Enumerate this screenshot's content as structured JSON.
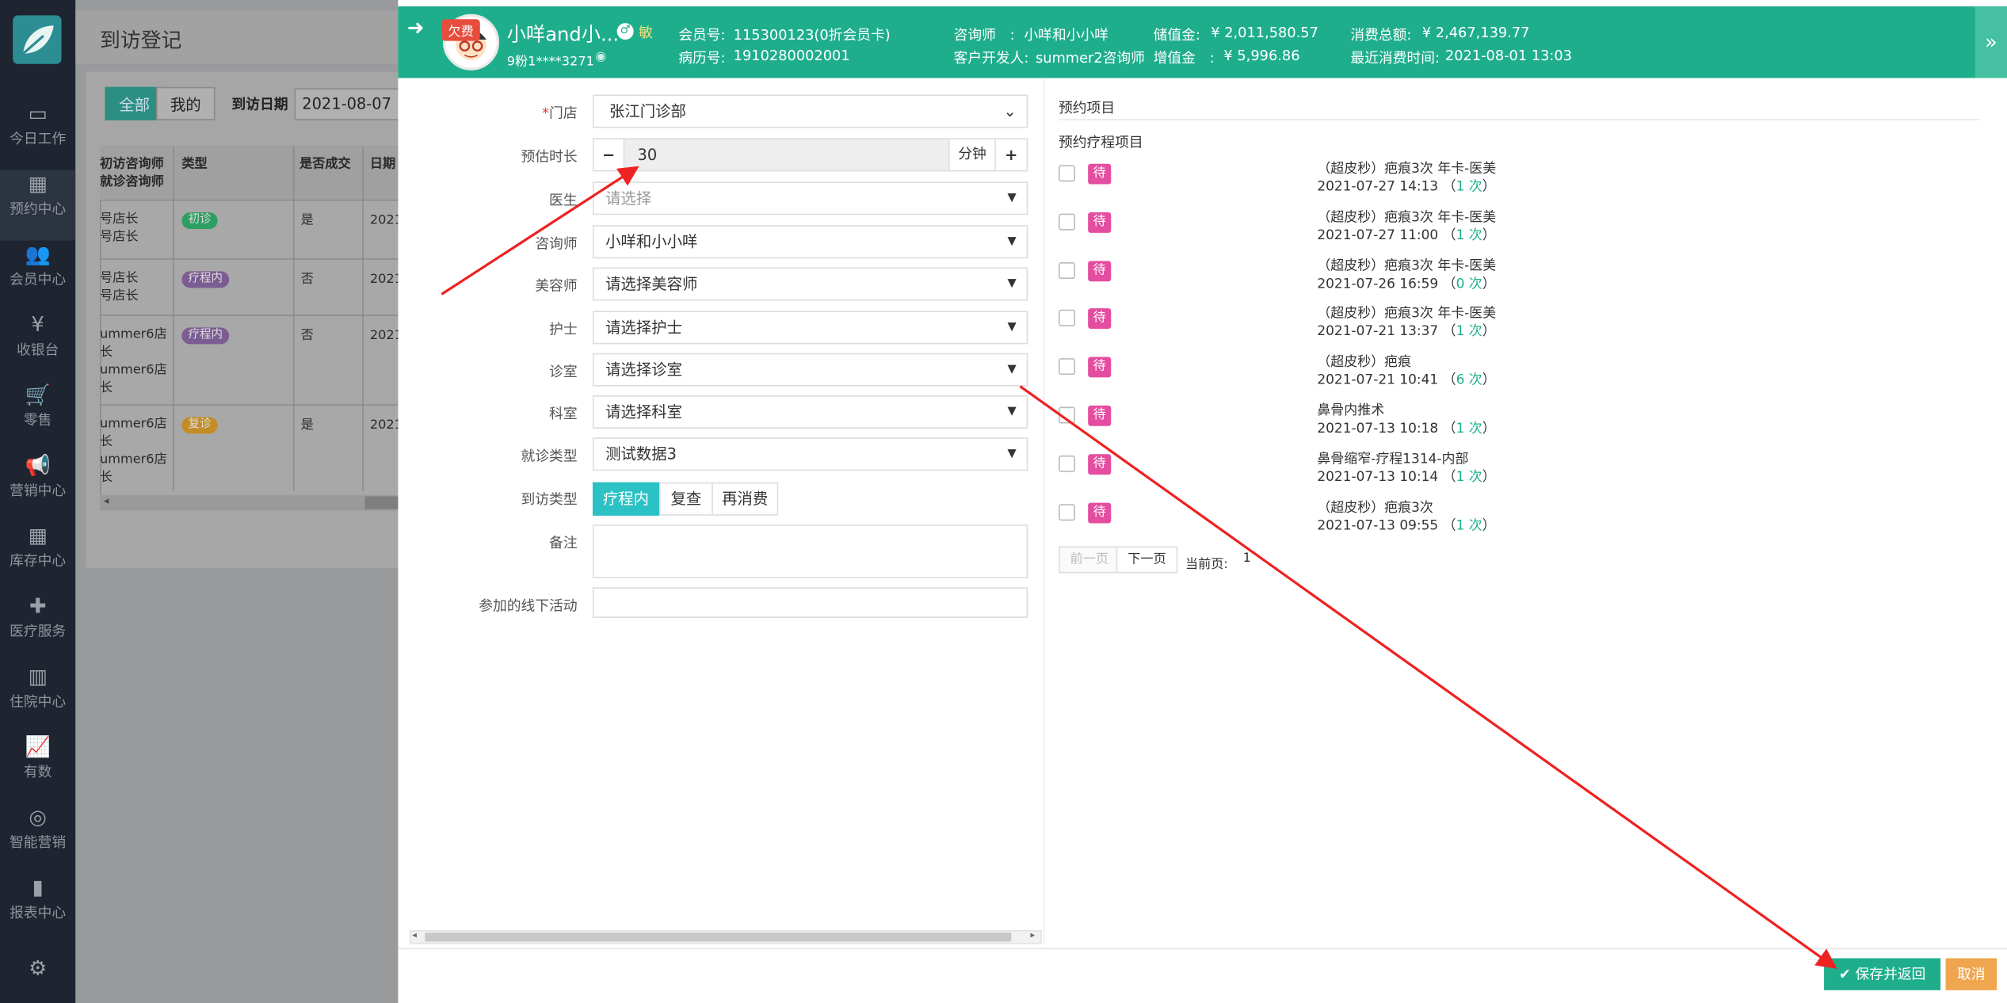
{
  "nav": {
    "items": [
      {
        "label": "今日工作",
        "icon": "monitor-icon"
      },
      {
        "label": "预约中心",
        "icon": "calendar-icon"
      },
      {
        "label": "会员中心",
        "icon": "users-icon"
      },
      {
        "label": "收银台",
        "icon": "yen-icon"
      },
      {
        "label": "零售",
        "icon": "cart-icon"
      },
      {
        "label": "营销中心",
        "icon": "megaphone-icon"
      },
      {
        "label": "库存中心",
        "icon": "grid-icon"
      },
      {
        "label": "医疗服务",
        "icon": "medkit-icon"
      },
      {
        "label": "住院中心",
        "icon": "building-icon"
      },
      {
        "label": "有数",
        "icon": "line-chart-icon"
      },
      {
        "label": "智能营销",
        "icon": "target-icon"
      },
      {
        "label": "报表中心",
        "icon": "bar-chart-icon"
      },
      {
        "label": "",
        "icon": "gear-icon"
      }
    ]
  },
  "bg": {
    "title": "到访登记",
    "tab_all": "全部",
    "tab_mine": "我的",
    "date_label": "到访日期",
    "date_value": "2021-08-07",
    "headers": [
      "初访咨询师\n就诊咨询师",
      "类型",
      "是否成交",
      "日期"
    ],
    "rows": [
      {
        "c1": "号店长\n号店长",
        "type": "初诊",
        "deal": "是",
        "date": "2021"
      },
      {
        "c1": "号店长\n号店长",
        "type": "疗程内",
        "deal": "否",
        "date": "2021"
      },
      {
        "c1": "ummer6店\n长\nummer6店\n长",
        "type": "疗程内",
        "deal": "否",
        "date": "2021"
      },
      {
        "c1": "ummer6店\n长\nummer6店\n长",
        "type": "复诊",
        "deal": "是",
        "date": "2021"
      }
    ]
  },
  "header": {
    "owe_badge": "欠费",
    "name": "小咩and小...",
    "sensitive_icon_label": "敏",
    "phone": "9粉1****3271",
    "member_no_label": "会员号:",
    "member_no": "115300123(0折会员卡)",
    "record_no_label": "病历号:",
    "record_no": "1910280002001",
    "consultant_label": "咨询师　:",
    "consultant": "小咩和小小咩",
    "developer_label": "客户开发人:",
    "developer": "summer2咨询师",
    "stored_label": "储值金:",
    "stored": "¥ 2,011,580.57",
    "bonus_label": "增值金　:",
    "bonus": "¥ 5,996.86",
    "total_label": "消费总额:",
    "total": "¥ 2,467,139.77",
    "last_label": "最近消费时间:",
    "last": "2021-08-01 13:03"
  },
  "form": {
    "store_label": "门店",
    "store_required": "*",
    "store": "张江门诊部",
    "duration_label": "预估时长",
    "duration": "30",
    "duration_unit": "分钟",
    "doctor_label": "医生",
    "doctor_placeholder": "请选择",
    "consultant_label": "咨询师",
    "consultant": "小咩和小小咩",
    "beautician_label": "美容师",
    "beautician": "请选择美容师",
    "nurse_label": "护士",
    "nurse": "请选择护士",
    "room_label": "诊室",
    "room": "请选择诊室",
    "dept_label": "科室",
    "dept": "请选择科室",
    "visit_kind_label": "就诊类型",
    "visit_kind": "测试数据3",
    "visit_type_label": "到访类型",
    "visit_types": [
      "疗程内",
      "复查",
      "再消费"
    ],
    "remark_label": "备注",
    "activity_label": "参加的线下活动"
  },
  "right": {
    "section_title": "预约项目",
    "sub_title": "预约疗程项目",
    "pending_label": "待执行",
    "items": [
      {
        "name": "（超皮秒）疤痕3次 年卡-医美",
        "date": "2021-07-27 14:13",
        "count": "1 次"
      },
      {
        "name": "（超皮秒）疤痕3次 年卡-医美",
        "date": "2021-07-27 11:00",
        "count": "1 次"
      },
      {
        "name": "（超皮秒）疤痕3次 年卡-医美",
        "date": "2021-07-26 16:59",
        "count": "0 次"
      },
      {
        "name": "（超皮秒）疤痕3次 年卡-医美",
        "date": "2021-07-21 13:37",
        "count": "1 次"
      },
      {
        "name": "（超皮秒）疤痕",
        "date": "2021-07-21 10:41",
        "count": "6 次"
      },
      {
        "name": "鼻骨内推术",
        "date": "2021-07-13 10:18",
        "count": "1 次"
      },
      {
        "name": "鼻骨缩窄-疗程1314-内部",
        "date": "2021-07-13 10:14",
        "count": "1 次"
      },
      {
        "name": "（超皮秒）疤痕3次",
        "date": "2021-07-13 09:55",
        "count": "1 次"
      }
    ],
    "prev": "前一页",
    "next": "下一页",
    "page_label": "当前页:",
    "page": "1"
  },
  "footer": {
    "save": "保存并返回",
    "cancel": "取消"
  },
  "colors": {
    "accent": "#1fae8c",
    "pending": "#e44da0",
    "cancel": "#f0a64e",
    "arrow": "#ee2222"
  }
}
